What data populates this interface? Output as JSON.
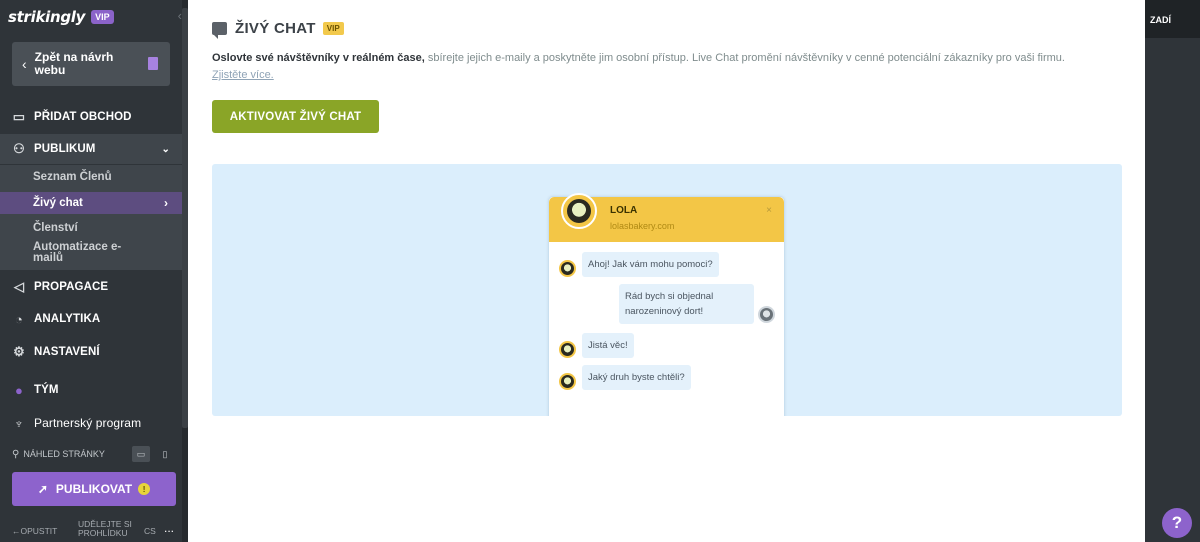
{
  "brand": {
    "logo": "strikingly",
    "vip": "VIP",
    "collapse_icon": "chevron-left-icon"
  },
  "back": {
    "label": "Zpět na návrh webu"
  },
  "nav": {
    "add_store": "PŘIDAT OBCHOD",
    "audience": "PUBLIKUM",
    "sub": {
      "members": "Seznam Členů",
      "live_chat": "Živý chat",
      "membership": "Členství",
      "email_automation": "Automatizace e-mailů"
    },
    "promotion": "PROPAGACE",
    "analytics": "ANALYTIKA",
    "settings": "NASTAVENÍ",
    "team": "TÝM",
    "partner": "Partnerský program"
  },
  "preview": {
    "label": "NÁHLED STRÁNKY"
  },
  "publish": {
    "label": "PUBLIKOVAT",
    "badge": "!"
  },
  "footer": {
    "exit": "OPUSTIT",
    "tour": "UDĚLEJTE SI PROHLÍDKU",
    "lang": "CS",
    "more": "..."
  },
  "main": {
    "title": "ŽIVÝ CHAT",
    "vip": "VIP",
    "desc_bold": "Oslovte své návštěvníky v reálném čase,",
    "desc_rest": " sbírejte jejich e-maily a poskytněte jim osobní přístup. Live Chat promění návštěvníky v cenné potenciální zákazníky pro vaši firmu.",
    "learn_more": "Zjistěte více.",
    "activate": "AKTIVOVAT ŽIVÝ CHAT"
  },
  "widget": {
    "name": "LOLA",
    "site": "lolasbakery.com",
    "close": "×",
    "messages": [
      "Ahoj! Jak vám mohu pomoci?",
      "Rád bych si objednal narozeninový dort!",
      "Jistá věc!",
      "Jaký druh byste chtěli?"
    ]
  },
  "right": {
    "label": "ZADÍ",
    "help": "?"
  },
  "colors": {
    "sidebar": "#2f3439",
    "accent": "#8d63cc",
    "activate": "#8aa527",
    "widget_head": "#f3c646",
    "preview_bg": "#dbeefc"
  }
}
